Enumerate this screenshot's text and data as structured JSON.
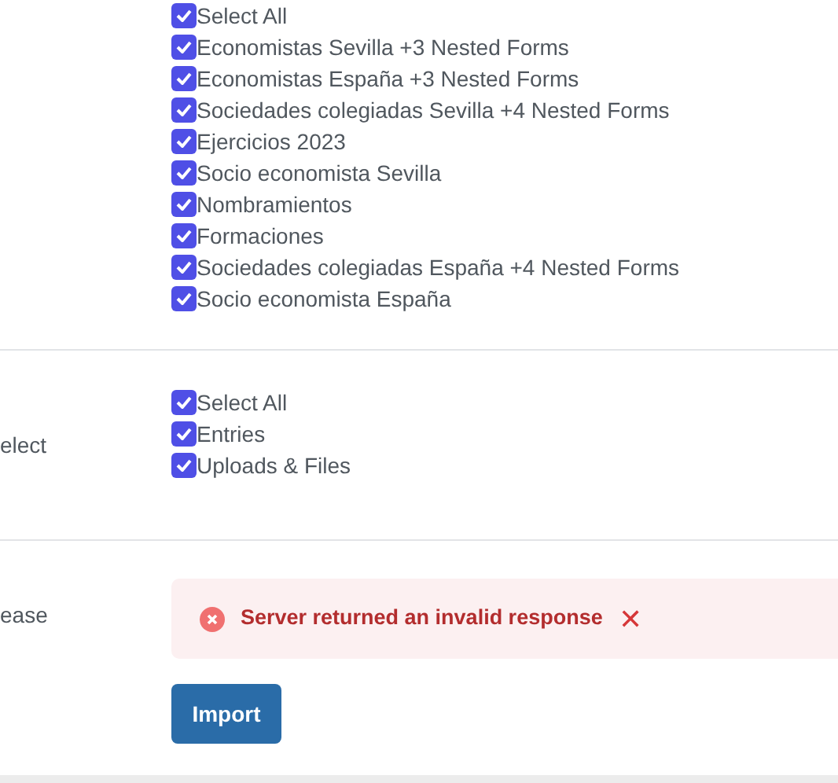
{
  "forms_section": {
    "options": [
      {
        "label": "Select All",
        "checked": true
      },
      {
        "label": "Economistas Sevilla +3 Nested Forms",
        "checked": true
      },
      {
        "label": "Economistas España +3 Nested Forms",
        "checked": true
      },
      {
        "label": "Sociedades colegiadas Sevilla +4 Nested Forms",
        "checked": true
      },
      {
        "label": "Ejercicios 2023",
        "checked": true
      },
      {
        "label": "Socio economista Sevilla",
        "checked": true
      },
      {
        "label": "Nombramientos",
        "checked": true
      },
      {
        "label": "Formaciones",
        "checked": true
      },
      {
        "label": "Sociedades colegiadas España +4 Nested Forms",
        "checked": true
      },
      {
        "label": "Socio economista España",
        "checked": true
      }
    ]
  },
  "data_section": {
    "label": "elect",
    "options": [
      {
        "label": "Select All",
        "checked": true
      },
      {
        "label": "Entries",
        "checked": true
      },
      {
        "label": "Uploads & Files",
        "checked": true
      }
    ]
  },
  "release_section": {
    "label": "ease",
    "error": {
      "message": "Server returned an invalid response",
      "dismiss": "✕"
    },
    "button": "Import"
  }
}
